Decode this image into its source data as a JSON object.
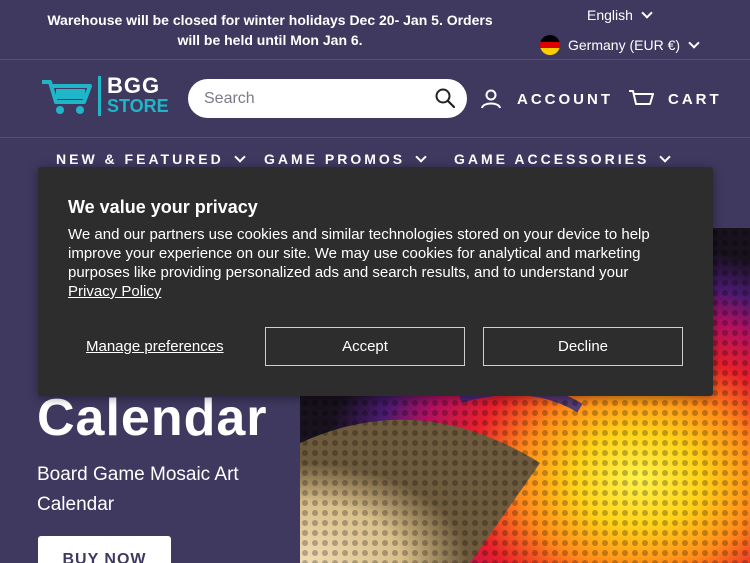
{
  "announcement": {
    "line1": "Warehouse will be closed for winter holidays Dec 20- Jan 5. Orders",
    "line2": "will be held until Mon Jan 6."
  },
  "locale": {
    "language": "English",
    "currency": "Germany (EUR €)"
  },
  "header": {
    "logo_line1": "BGG",
    "logo_line2": "STORE",
    "search_placeholder": "Search",
    "account_label": "ACCOUNT",
    "cart_label": "CART"
  },
  "nav": {
    "items": [
      {
        "label": "NEW & FEATURED"
      },
      {
        "label": "GAME PROMOS"
      },
      {
        "label": "GAME ACCESSORIES"
      }
    ]
  },
  "hero": {
    "title": "Calendar",
    "subtitle": "Board Game Mosaic Art Calendar",
    "button_label": "BUY NOW"
  },
  "cookie_banner": {
    "title": "We value your privacy",
    "body": "We and our partners use cookies and similar technologies stored on your device to help improve your experience on our site. We may use cookies for analytical and marketing purposes like providing personalized ads and search results, and to understand your",
    "policy_link": "Privacy Policy",
    "manage_label": "Manage preferences",
    "accept_label": "Accept",
    "decline_label": "Decline"
  },
  "colors": {
    "background": "#3f3960",
    "accent": "#1fb6c9",
    "banner": "#2d2d2d"
  }
}
